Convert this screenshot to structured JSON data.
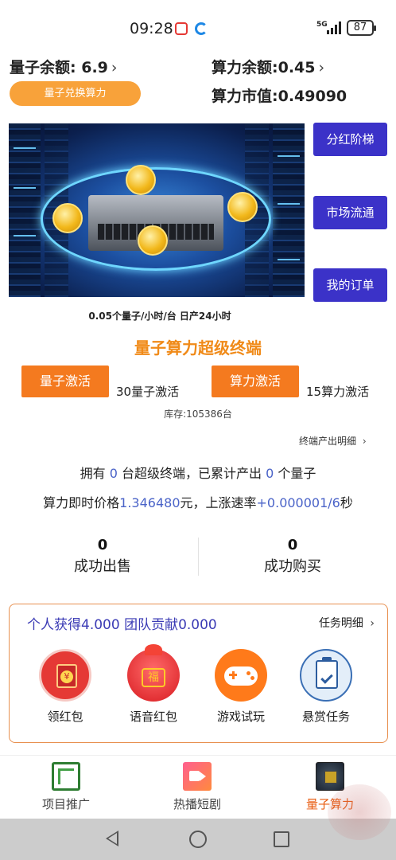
{
  "status_bar": {
    "time": "09:28",
    "signal": "5G",
    "battery": "87"
  },
  "balances": {
    "quantum_label": "量子余额:",
    "quantum_value": "6.9",
    "power_label": "算力余额:",
    "power_value": "0.45",
    "market_label": "算力市值:",
    "market_value": "0.49090",
    "exchange_button": "量子兑换算力"
  },
  "side_buttons": [
    "分红阶梯",
    "市场流通",
    "我的订单"
  ],
  "product": {
    "rate_text": "0.05个量子/小时/台  日产24小时",
    "title": "量子算力超级终端",
    "activate_quantum_label": "量子激活",
    "activate_quantum_note": "30量子激活",
    "activate_power_label": "算力激活",
    "activate_power_note": "15算力激活",
    "stock": "库存:105386台",
    "detail_link": "终端产出明细"
  },
  "ownership": {
    "prefix": "拥有",
    "terminals": "0",
    "middle": "台超级终端，已累计产出",
    "produced": "0",
    "suffix": "个量子"
  },
  "price": {
    "prefix": "算力即时价格",
    "value": "1.346480",
    "middle": "元，上涨速率",
    "rate": "+0.000001/6",
    "suffix": "秒"
  },
  "stats": {
    "sold_value": "0",
    "sold_label": "成功出售",
    "bought_value": "0",
    "bought_label": "成功购买"
  },
  "tasks": {
    "summary": "个人获得4.000 团队贡献0.000",
    "detail_link": "任务明细",
    "items": [
      {
        "label": "领红包",
        "icon": "red-envelope-icon"
      },
      {
        "label": "语音红包",
        "icon": "lucky-bag-icon"
      },
      {
        "label": "游戏试玩",
        "icon": "gamepad-icon"
      },
      {
        "label": "悬赏任务",
        "icon": "clipboard-check-icon"
      }
    ]
  },
  "tabs": [
    {
      "label": "项目推广",
      "icon": "ad-icon"
    },
    {
      "label": "热播短剧",
      "icon": "video-icon"
    },
    {
      "label": "量子算力",
      "icon": "chip-icon",
      "active": true
    }
  ],
  "colors": {
    "accent_orange": "#f47a1f",
    "side_button_purple": "#3b32c8",
    "link_blue": "#4a63c8"
  }
}
